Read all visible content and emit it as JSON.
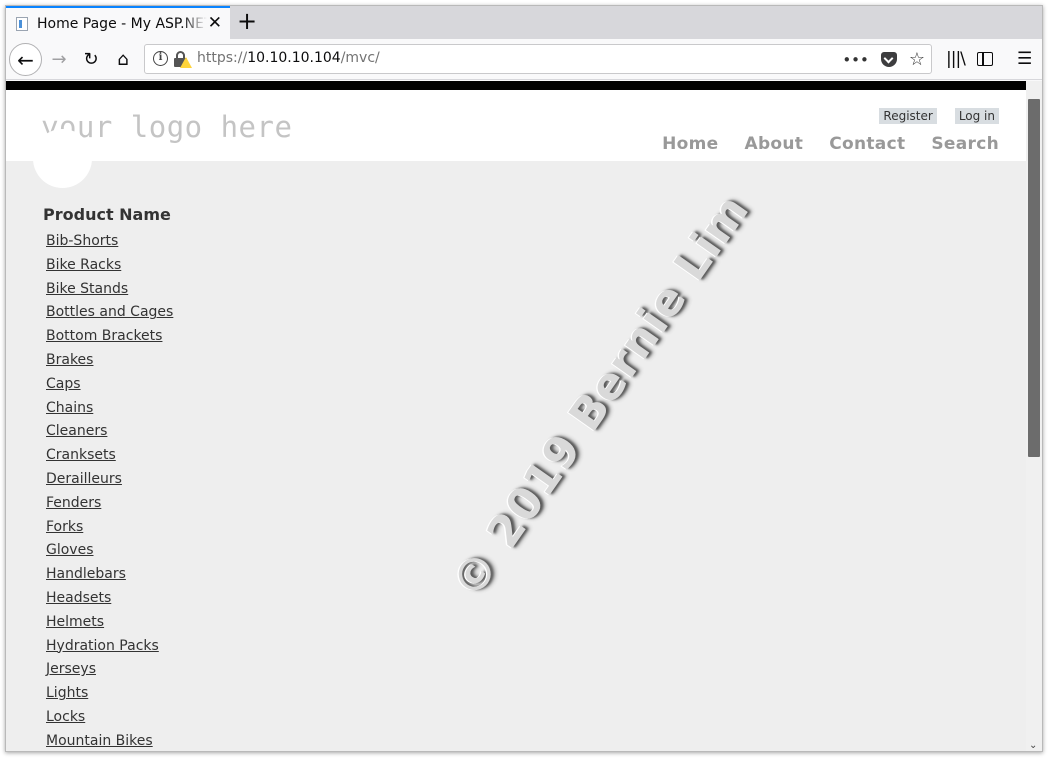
{
  "browser": {
    "tab_title": "Home Page - My ASP.NET Application",
    "tab_close": "✕",
    "new_tab": "+",
    "url_prefix": "https://",
    "url_host": "10.10.10.104",
    "url_path": "/mvc/",
    "page_actions": "•••",
    "nav": {
      "back": "←",
      "forward": "→",
      "reload": "↻",
      "home": "⌂",
      "library": "|||\\",
      "menu": "☰",
      "star": "☆"
    }
  },
  "site": {
    "logo": "your logo here",
    "auth": {
      "register": "Register",
      "login": "Log in"
    },
    "nav": [
      "Home",
      "About",
      "Contact",
      "Search"
    ]
  },
  "products": {
    "heading": "Product Name",
    "items": [
      "Bib-Shorts",
      "Bike Racks",
      "Bike Stands",
      "Bottles and Cages",
      "Bottom Brackets",
      "Brakes",
      "Caps",
      "Chains",
      "Cleaners",
      "Cranksets",
      "Derailleurs",
      "Fenders",
      "Forks",
      "Gloves",
      "Handlebars",
      "Headsets",
      "Helmets",
      "Hydration Packs",
      "Jerseys",
      "Lights",
      "Locks",
      "Mountain Bikes"
    ]
  },
  "watermark": "© 2019 Bernie Lim"
}
